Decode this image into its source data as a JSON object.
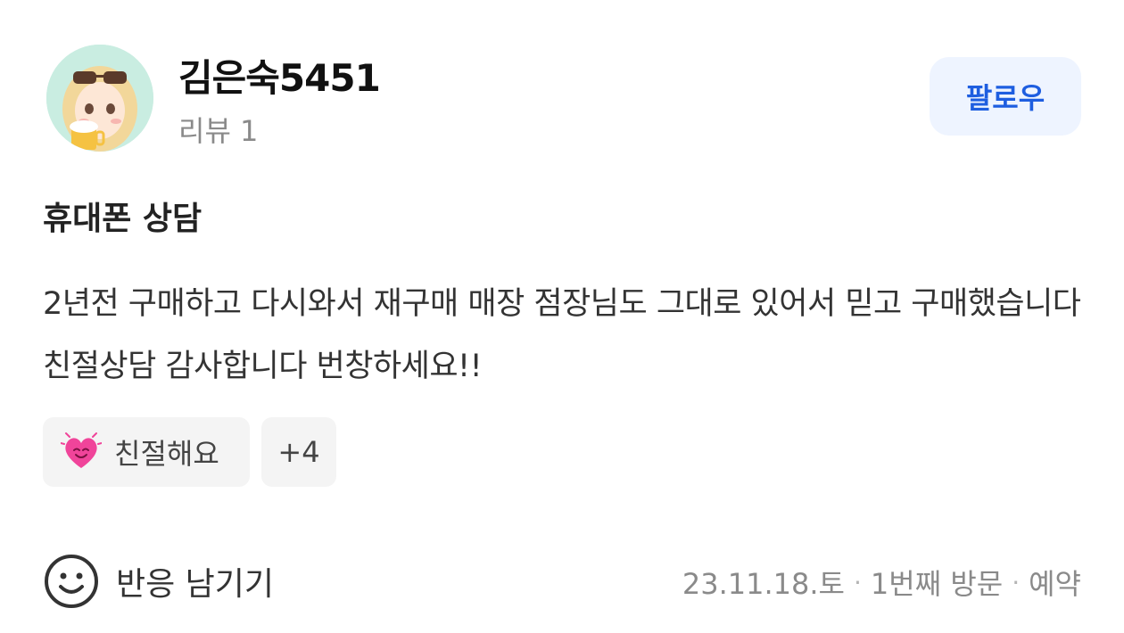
{
  "author": {
    "name": "김은숙5451",
    "review_count_label": "리뷰 1",
    "avatar_icon": "avatar-sunglasses-beer-icon"
  },
  "follow_button": {
    "label": "팔로우",
    "color": "#1e5ee0",
    "background": "#eef4ff"
  },
  "review": {
    "title": "휴대폰 상담",
    "body": "2년전 구매하고 다시와서 재구매 매장 점장님도 그대로 있어서 믿고 구매했습니다 친절상담 감사합니다 번창하세요!!"
  },
  "keywords": [
    {
      "icon": "heart-smile-icon",
      "label": "친절해요"
    },
    {
      "label": "+4"
    }
  ],
  "reaction": {
    "icon": "smile-icon",
    "label": "반응 남기기"
  },
  "visit_meta": {
    "date": "23.11.18.토",
    "visit_count": "1번째 방문",
    "type": "예약",
    "separator": "·"
  }
}
